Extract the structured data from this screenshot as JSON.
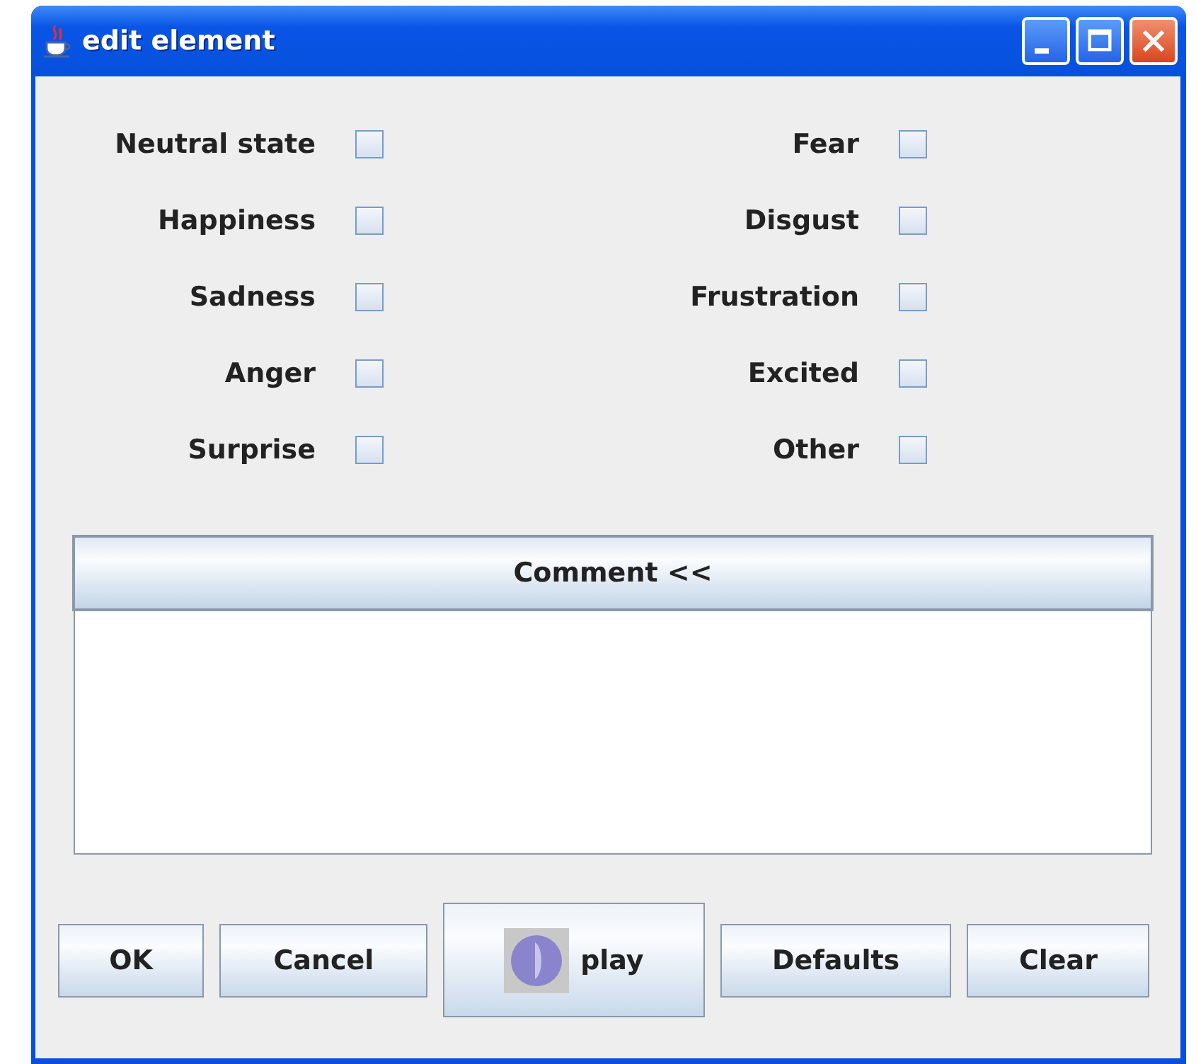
{
  "window": {
    "title": "edit element"
  },
  "emotions_left": [
    {
      "label": "Neutral state",
      "checked": false
    },
    {
      "label": "Happiness",
      "checked": false
    },
    {
      "label": "Sadness",
      "checked": false
    },
    {
      "label": "Anger",
      "checked": false
    },
    {
      "label": "Surprise",
      "checked": false
    }
  ],
  "emotions_right": [
    {
      "label": "Fear",
      "checked": false
    },
    {
      "label": "Disgust",
      "checked": false
    },
    {
      "label": "Frustration",
      "checked": false
    },
    {
      "label": "Excited",
      "checked": false
    },
    {
      "label": "Other",
      "checked": false
    }
  ],
  "comment": {
    "toggle": "Comment <<"
  },
  "buttons": [
    {
      "label": "OK",
      "kind": "plain"
    },
    {
      "label": "Cancel",
      "kind": "plain"
    },
    {
      "label": "play",
      "kind": "play"
    },
    {
      "label": "Defaults",
      "kind": "plain"
    },
    {
      "label": "Clear",
      "kind": "plain"
    }
  ]
}
